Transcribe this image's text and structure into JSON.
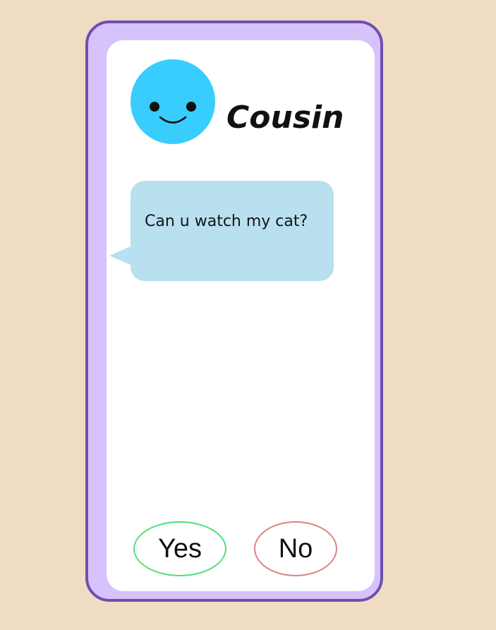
{
  "contact": {
    "name": "Cousin",
    "avatar_icon": "smiley-face-icon",
    "avatar_color": "#38cdfd"
  },
  "message": {
    "text": "Can u watch my cat?",
    "bubble_color": "#b8e0ef"
  },
  "choices": {
    "yes_label": "Yes",
    "no_label": "No",
    "yes_color": "#4fe07a",
    "no_color": "#d98484"
  },
  "colors": {
    "background": "#efdcc2",
    "phone_frame": "#d7c3fb",
    "phone_border": "#6f4fb0",
    "screen": "#ffffff"
  }
}
